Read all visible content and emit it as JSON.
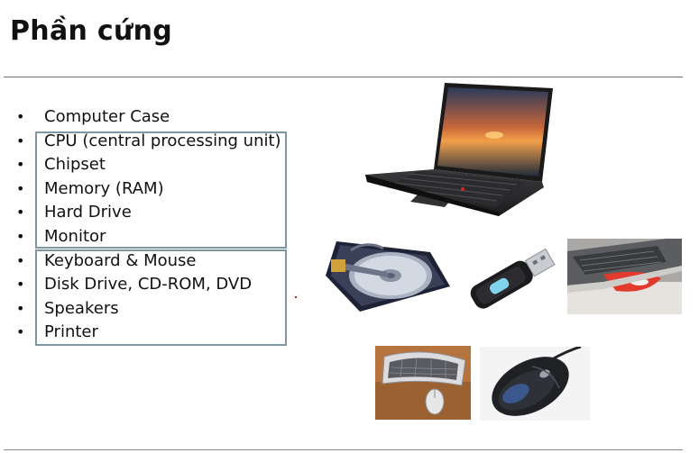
{
  "slide": {
    "title": "Phần cứng",
    "items": [
      {
        "bullet": "•",
        "label": "Computer Case"
      },
      {
        "bullet": "•",
        "label": "CPU (central processing unit)"
      },
      {
        "bullet": "•",
        "label": "Chipset"
      },
      {
        "bullet": "•",
        "label": "Memory (RAM)"
      },
      {
        "bullet": "•",
        "label": "Hard Drive"
      },
      {
        "bullet": "•",
        "label": "Monitor"
      },
      {
        "bullet": "•",
        "label": "Keyboard & Mouse"
      },
      {
        "bullet": "•",
        "label": "Disk Drive, CD-ROM, DVD"
      },
      {
        "bullet": "•",
        "label": "Speakers"
      },
      {
        "bullet": "•",
        "label": "Printer"
      }
    ],
    "images": [
      "laptop-image",
      "hard-drive-image",
      "usb-flash-drive-image",
      "optical-disc-drive-image",
      "keyboard-mouse-image",
      "mouse-image"
    ],
    "colors": {
      "text": "#111111",
      "box_border": "#7f97a3",
      "rule": "#6d6d6d"
    }
  }
}
